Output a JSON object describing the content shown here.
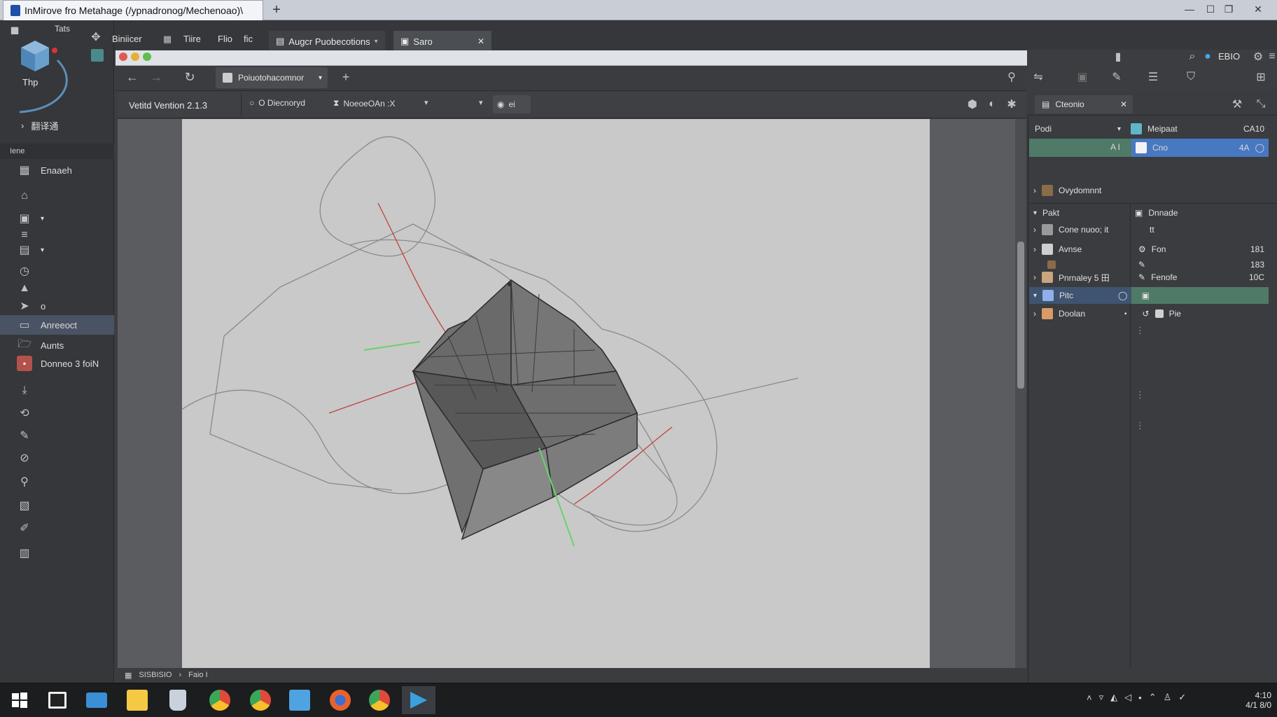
{
  "window": {
    "title": "InMirove fro Metahage (/ypnadronog/Mechenoao)\\",
    "new_tab": "+",
    "controls": {
      "minimize": "—",
      "maximize": "☐",
      "restore": "❐",
      "close": "✕"
    }
  },
  "sidebar": {
    "top_label": "Tats",
    "logo_label": "Thp",
    "expand_label": "翻译通",
    "section_label": "Iene",
    "items": [
      {
        "label": "Enaaeh",
        "icon": "grid-icon"
      },
      {
        "label": "",
        "icon": "home-icon"
      },
      {
        "label": "",
        "icon": "image-icon"
      },
      {
        "label": "",
        "icon": "layers-icon"
      },
      {
        "label": "",
        "icon": "table-icon"
      },
      {
        "label": "",
        "icon": "clock-icon"
      },
      {
        "label": "",
        "icon": "triangle-icon"
      },
      {
        "label": "o",
        "icon": "play-icon"
      },
      {
        "label": "Anreeoct",
        "icon": "panel-icon",
        "selected": true
      },
      {
        "label": "Aunts",
        "icon": "folder-icon"
      },
      {
        "label": "Donneo 3 foiN",
        "icon": "photo-icon"
      },
      {
        "label": "",
        "icon": "download-icon"
      },
      {
        "label": "",
        "icon": "lasso-icon"
      },
      {
        "label": "",
        "icon": "pen-icon"
      },
      {
        "label": "",
        "icon": "brush-icon"
      },
      {
        "label": "",
        "icon": "user-icon"
      },
      {
        "label": "",
        "icon": "chart-icon"
      },
      {
        "label": "",
        "icon": "wand-icon"
      },
      {
        "label": "",
        "icon": "clipboard-icon"
      }
    ]
  },
  "menubar": {
    "items": [
      "Biniicer",
      "Tiire",
      "Flio",
      "fic"
    ],
    "tabs": [
      {
        "label": "Augcr Puobecotions",
        "active": false
      },
      {
        "label": "Saro",
        "active": true
      }
    ],
    "right_label": "EBIO"
  },
  "browser": {
    "url_label": "Poiuotohacomnor",
    "new_tab": "+"
  },
  "toolbar": {
    "version": "Vetitd Vention 2.1.3",
    "dropdown1": "O Diecnoryd",
    "dropdown2": "NoeoeOAn :X",
    "dropdown3": "ei"
  },
  "statusbar": {
    "left": "SISBISIO",
    "mid": "Faio I"
  },
  "right_panel": {
    "tab_label": "Cteonio",
    "rows": [
      {
        "label": "Podi",
        "right_label": "Meipaat",
        "value": "CA10"
      },
      {
        "label": "A I",
        "right_label": "Cno",
        "value": "4A"
      },
      {
        "label": "Ovydomnnt"
      },
      {
        "label": "Pakt",
        "right_label": "Dnnade"
      },
      {
        "label": "Cone nuoo; it",
        "right_label": "tt"
      },
      {
        "label": "Avnse",
        "right_label": "Fon",
        "value": "181"
      },
      {
        "label": "",
        "right_label": "",
        "value": "183"
      },
      {
        "label": "Pnrnaley 5 田",
        "right_label": "Fenofe",
        "value": "10C"
      },
      {
        "label": "Pitc",
        "right_label": ""
      },
      {
        "label": "Doolan",
        "right_label": "Pie"
      }
    ]
  },
  "taskbar": {
    "apps": [
      "start-icon",
      "task-view-icon",
      "explorer-icon",
      "folder-icon",
      "trash-icon",
      "chrome-icon",
      "chrome-icon",
      "calendar-icon",
      "firefox-icon",
      "chrome-icon",
      "media-player-icon"
    ],
    "time": "4:10",
    "date": "4/1 8/0"
  },
  "colors": {
    "accent_blue": "#4978c2",
    "accent_green": "#4f7a67",
    "panel_dark": "#35373a"
  }
}
